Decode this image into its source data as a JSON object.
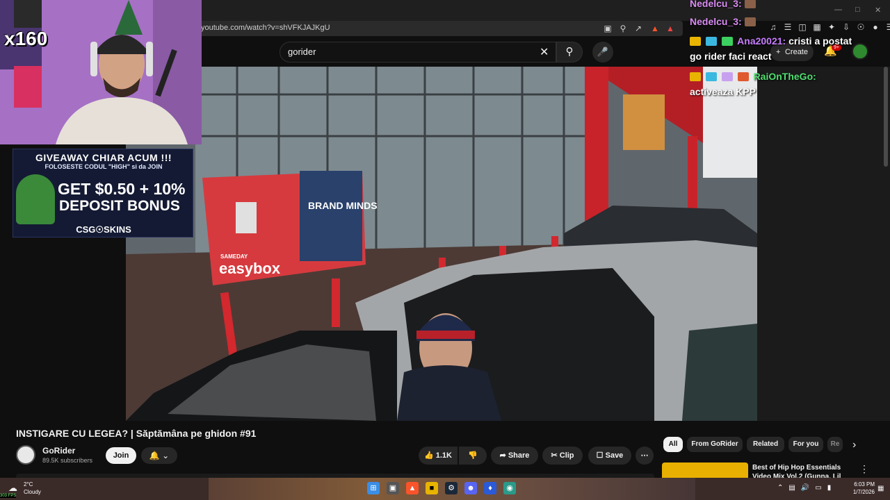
{
  "browser": {
    "url": "youtube.com/watch?v=shVFKJAJKgU"
  },
  "search": {
    "query": "gorider"
  },
  "header": {
    "create_label": "Create",
    "notif_count": "9+"
  },
  "stream_overlay": {
    "webcam_badge": "x160",
    "ad": {
      "title": "GIVEAWAY CHIAR ACUM !!!",
      "subtitle": "FOLOSESTE CODUL \"HIGH\" si da JOIN",
      "line1": "GET $0.50 + 10%",
      "line2": "DEPOSIT BONUS",
      "brand": "CSG☉SKINS"
    },
    "chat": [
      {
        "user": "Nedelcu_3:",
        "message": ""
      },
      {
        "user": "Nedelcu_3:",
        "message": ""
      },
      {
        "user": "Ana20021:",
        "message": "cristi a postat"
      },
      {
        "user": "",
        "message": "go rider faci react"
      },
      {
        "user": "RaiOnTheGo:",
        "message": ""
      },
      {
        "user": "",
        "message": "activeaza KPP"
      }
    ]
  },
  "video_scene": {
    "sign_brand": "BRAND MINDS",
    "locker_brand": "easybox",
    "locker_prefix": "SAMEDAY"
  },
  "video": {
    "title": "INSTIGARE CU LEGEA? | Săptămâna pe ghidon #91",
    "channel": "GoRider",
    "subscribers": "89.5K subscribers",
    "join_label": "Join",
    "likes": "1.1K",
    "share_label": "Share",
    "clip_label": "Clip",
    "save_label": "Save"
  },
  "chips": [
    "All",
    "From GoRider",
    "Related",
    "For you",
    "Re"
  ],
  "recommended": {
    "title": "Best of Hip Hop Essentials Video Mix Vol.2 (Gunna, Lil"
  },
  "taskbar": {
    "temperature": "2°C",
    "condition": "Cloudy",
    "fps": "303 FPS",
    "time": "6:03 PM",
    "date": "1/7/2026"
  },
  "colors": {
    "yt_bg": "#0f0f0f",
    "pill_bg": "#272727",
    "accent_red": "#cc0000"
  }
}
